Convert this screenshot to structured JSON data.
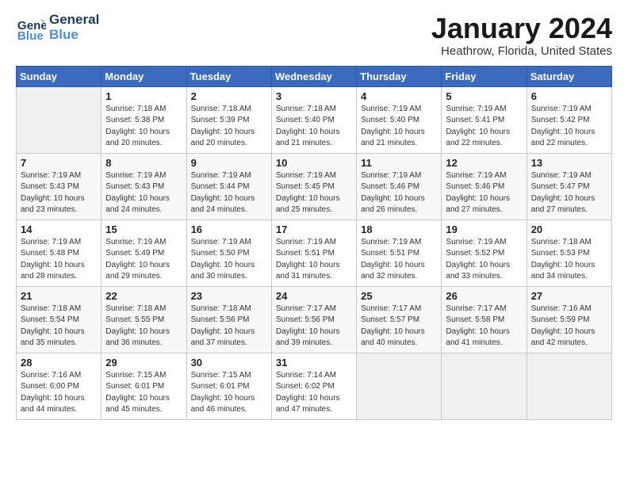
{
  "header": {
    "logo_line1": "General",
    "logo_line2": "Blue",
    "month_title": "January 2024",
    "location": "Heathrow, Florida, United States"
  },
  "days_of_week": [
    "Sunday",
    "Monday",
    "Tuesday",
    "Wednesday",
    "Thursday",
    "Friday",
    "Saturday"
  ],
  "weeks": [
    [
      {
        "num": "",
        "empty": true
      },
      {
        "num": "1",
        "sunrise": "7:18 AM",
        "sunset": "5:38 PM",
        "daylight": "10 hours and 20 minutes."
      },
      {
        "num": "2",
        "sunrise": "7:18 AM",
        "sunset": "5:39 PM",
        "daylight": "10 hours and 20 minutes."
      },
      {
        "num": "3",
        "sunrise": "7:18 AM",
        "sunset": "5:40 PM",
        "daylight": "10 hours and 21 minutes."
      },
      {
        "num": "4",
        "sunrise": "7:19 AM",
        "sunset": "5:40 PM",
        "daylight": "10 hours and 21 minutes."
      },
      {
        "num": "5",
        "sunrise": "7:19 AM",
        "sunset": "5:41 PM",
        "daylight": "10 hours and 22 minutes."
      },
      {
        "num": "6",
        "sunrise": "7:19 AM",
        "sunset": "5:42 PM",
        "daylight": "10 hours and 22 minutes."
      }
    ],
    [
      {
        "num": "7",
        "sunrise": "7:19 AM",
        "sunset": "5:43 PM",
        "daylight": "10 hours and 23 minutes."
      },
      {
        "num": "8",
        "sunrise": "7:19 AM",
        "sunset": "5:43 PM",
        "daylight": "10 hours and 24 minutes."
      },
      {
        "num": "9",
        "sunrise": "7:19 AM",
        "sunset": "5:44 PM",
        "daylight": "10 hours and 24 minutes."
      },
      {
        "num": "10",
        "sunrise": "7:19 AM",
        "sunset": "5:45 PM",
        "daylight": "10 hours and 25 minutes."
      },
      {
        "num": "11",
        "sunrise": "7:19 AM",
        "sunset": "5:46 PM",
        "daylight": "10 hours and 26 minutes."
      },
      {
        "num": "12",
        "sunrise": "7:19 AM",
        "sunset": "5:46 PM",
        "daylight": "10 hours and 27 minutes."
      },
      {
        "num": "13",
        "sunrise": "7:19 AM",
        "sunset": "5:47 PM",
        "daylight": "10 hours and 27 minutes."
      }
    ],
    [
      {
        "num": "14",
        "sunrise": "7:19 AM",
        "sunset": "5:48 PM",
        "daylight": "10 hours and 28 minutes."
      },
      {
        "num": "15",
        "sunrise": "7:19 AM",
        "sunset": "5:49 PM",
        "daylight": "10 hours and 29 minutes."
      },
      {
        "num": "16",
        "sunrise": "7:19 AM",
        "sunset": "5:50 PM",
        "daylight": "10 hours and 30 minutes."
      },
      {
        "num": "17",
        "sunrise": "7:19 AM",
        "sunset": "5:51 PM",
        "daylight": "10 hours and 31 minutes."
      },
      {
        "num": "18",
        "sunrise": "7:19 AM",
        "sunset": "5:51 PM",
        "daylight": "10 hours and 32 minutes."
      },
      {
        "num": "19",
        "sunrise": "7:19 AM",
        "sunset": "5:52 PM",
        "daylight": "10 hours and 33 minutes."
      },
      {
        "num": "20",
        "sunrise": "7:18 AM",
        "sunset": "5:53 PM",
        "daylight": "10 hours and 34 minutes."
      }
    ],
    [
      {
        "num": "21",
        "sunrise": "7:18 AM",
        "sunset": "5:54 PM",
        "daylight": "10 hours and 35 minutes."
      },
      {
        "num": "22",
        "sunrise": "7:18 AM",
        "sunset": "5:55 PM",
        "daylight": "10 hours and 36 minutes."
      },
      {
        "num": "23",
        "sunrise": "7:18 AM",
        "sunset": "5:56 PM",
        "daylight": "10 hours and 37 minutes."
      },
      {
        "num": "24",
        "sunrise": "7:17 AM",
        "sunset": "5:56 PM",
        "daylight": "10 hours and 39 minutes."
      },
      {
        "num": "25",
        "sunrise": "7:17 AM",
        "sunset": "5:57 PM",
        "daylight": "10 hours and 40 minutes."
      },
      {
        "num": "26",
        "sunrise": "7:17 AM",
        "sunset": "5:58 PM",
        "daylight": "10 hours and 41 minutes."
      },
      {
        "num": "27",
        "sunrise": "7:16 AM",
        "sunset": "5:59 PM",
        "daylight": "10 hours and 42 minutes."
      }
    ],
    [
      {
        "num": "28",
        "sunrise": "7:16 AM",
        "sunset": "6:00 PM",
        "daylight": "10 hours and 44 minutes."
      },
      {
        "num": "29",
        "sunrise": "7:15 AM",
        "sunset": "6:01 PM",
        "daylight": "10 hours and 45 minutes."
      },
      {
        "num": "30",
        "sunrise": "7:15 AM",
        "sunset": "6:01 PM",
        "daylight": "10 hours and 46 minutes."
      },
      {
        "num": "31",
        "sunrise": "7:14 AM",
        "sunset": "6:02 PM",
        "daylight": "10 hours and 47 minutes."
      },
      {
        "num": "",
        "empty": true
      },
      {
        "num": "",
        "empty": true
      },
      {
        "num": "",
        "empty": true
      }
    ]
  ]
}
